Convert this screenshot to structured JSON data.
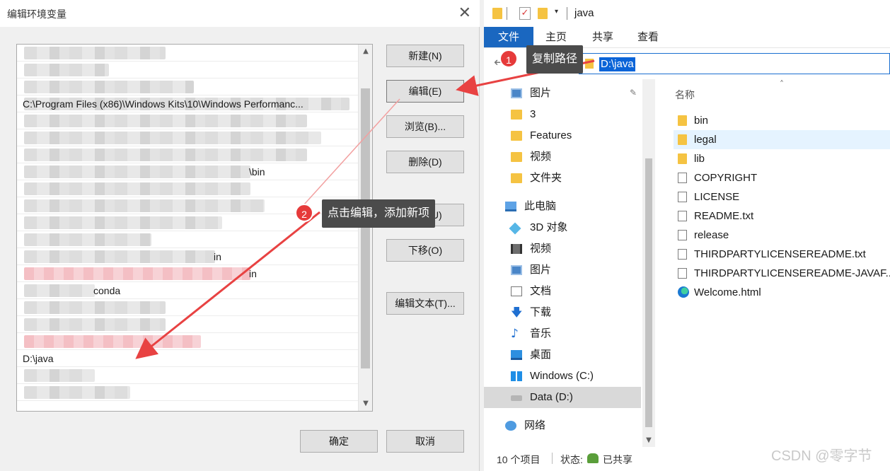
{
  "dialog": {
    "title": "编辑环境变量",
    "close_glyph": "✕",
    "rows": [
      {
        "text": "",
        "blurred": true
      },
      {
        "text": "",
        "blurred": true
      },
      {
        "text": "",
        "blurred": true
      },
      {
        "text": "C:\\Program Files (x86)\\Windows Kits\\10\\Windows Performanc...",
        "blurred": true
      },
      {
        "text": "",
        "blurred": true
      },
      {
        "text": "",
        "blurred": true
      },
      {
        "text": "",
        "blurred": true
      },
      {
        "text": "\\bin",
        "blurred": true
      },
      {
        "text": "",
        "blurred": true
      },
      {
        "text": "",
        "blurred": true
      },
      {
        "text": "",
        "blurred": true
      },
      {
        "text": "",
        "blurred": true
      },
      {
        "text": "in",
        "blurred": true
      },
      {
        "text": "in",
        "blurred": true
      },
      {
        "text": "conda",
        "blurred": true
      },
      {
        "text": "",
        "blurred": true
      },
      {
        "text": "",
        "blurred": true
      },
      {
        "text": "",
        "blurred": true
      },
      {
        "text": "D:\\java",
        "blurred": false
      },
      {
        "text": "",
        "blurred": true
      },
      {
        "text": "",
        "blurred": true
      }
    ],
    "scroll_up_glyph": "▲",
    "scroll_down_glyph": "▼",
    "buttons": {
      "new": "新建(N)",
      "edit": "编辑(E)",
      "browse": "浏览(B)...",
      "delete": "删除(D)",
      "move_up": "上移(U)",
      "move_down": "下移(O)",
      "edit_text": "编辑文本(T)...",
      "ok": "确定",
      "cancel": "取消"
    }
  },
  "explorer": {
    "window_title": "java",
    "qat_check_glyph": "✓",
    "qat_dropdown_glyph": "▾",
    "ribbon_tabs": [
      "文件",
      "主页",
      "共享",
      "查看"
    ],
    "back_glyph": "←",
    "address": "D:\\java",
    "pin_glyph": "✎",
    "nav_items": [
      {
        "label": "图片",
        "icon": "pictures-icon"
      },
      {
        "label": "3",
        "icon": "folder-icon"
      },
      {
        "label": "Features",
        "icon": "folder-icon"
      },
      {
        "label": "视频",
        "icon": "folder-icon"
      },
      {
        "label": "文件夹",
        "icon": "folder-icon"
      },
      {
        "label": "此电脑",
        "icon": "this-pc-icon"
      },
      {
        "label": "3D 对象",
        "icon": "3d-objects-icon"
      },
      {
        "label": "视频",
        "icon": "videos-icon"
      },
      {
        "label": "图片",
        "icon": "pictures-icon"
      },
      {
        "label": "文档",
        "icon": "documents-icon"
      },
      {
        "label": "下载",
        "icon": "downloads-icon"
      },
      {
        "label": "音乐",
        "icon": "music-icon"
      },
      {
        "label": "桌面",
        "icon": "desktop-icon"
      },
      {
        "label": "Windows (C:)",
        "icon": "windows-drive-icon"
      },
      {
        "label": "Data (D:)",
        "icon": "drive-icon"
      },
      {
        "label": "网络",
        "icon": "network-icon"
      }
    ],
    "download_glyph": "🡇",
    "music_glyph": "♪",
    "column_name": "名称",
    "sort_glyph": "˄",
    "scroll_down_glyph": "▼",
    "files": [
      {
        "name": "bin",
        "type": "folder"
      },
      {
        "name": "legal",
        "type": "folder"
      },
      {
        "name": "lib",
        "type": "folder"
      },
      {
        "name": "COPYRIGHT",
        "type": "file"
      },
      {
        "name": "LICENSE",
        "type": "file"
      },
      {
        "name": "README.txt",
        "type": "text"
      },
      {
        "name": "release",
        "type": "file"
      },
      {
        "name": "THIRDPARTYLICENSEREADME.txt",
        "type": "text"
      },
      {
        "name": "THIRDPARTYLICENSEREADME-JAVAF...",
        "type": "text"
      },
      {
        "name": "Welcome.html",
        "type": "edge"
      }
    ],
    "status": {
      "count": "10 个项目",
      "state_label": "状态:",
      "shared": "已共享"
    }
  },
  "annotations": {
    "step1": {
      "number": "1",
      "text": "复制路径"
    },
    "step2": {
      "number": "2",
      "text": "点击编辑，添加新项"
    }
  },
  "watermark": "CSDN @零字节",
  "colors": {
    "accent_blue": "#1a67c0",
    "selection_blue": "#0a64d8",
    "arrow_red": "#e84242",
    "callout_bg": "#4b4b4b"
  }
}
